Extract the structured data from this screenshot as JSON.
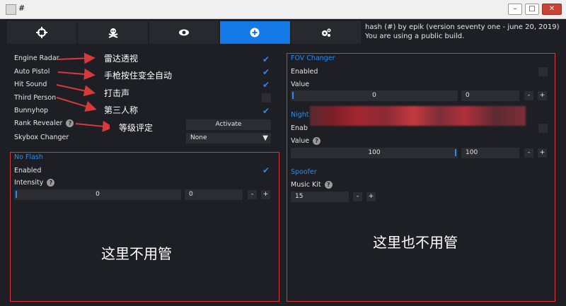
{
  "window": {
    "title": "#"
  },
  "tabs": [
    {
      "name": "aim-tab",
      "icon": "crosshair-icon"
    },
    {
      "name": "skull-tab",
      "icon": "skull-crossbones-icon"
    },
    {
      "name": "visuals-tab",
      "icon": "eye-icon"
    },
    {
      "name": "misc-tab",
      "icon": "plus-circle-icon",
      "active": true
    },
    {
      "name": "settings-tab",
      "icon": "gears-icon"
    }
  ],
  "info": {
    "line1": "hash (#) by epik (version seventy one - june 20, 2019)",
    "line2": "You are using a public build."
  },
  "misc": {
    "engine_radar": "Engine Radar",
    "auto_pistol": "Auto Pistol",
    "hit_sound": "Hit Sound",
    "third_person": "Third Person",
    "bunnyhop": "Bunnyhop",
    "rank_revealer": "Rank Revealer",
    "rank_activate": "Activate",
    "skybox_changer": "Skybox Changer",
    "skybox_value": "None"
  },
  "no_flash": {
    "title": "No Flash",
    "enabled": "Enabled",
    "intensity": "Intensity",
    "value1": "0",
    "value2": "0",
    "minus": "-",
    "plus": "+"
  },
  "fov_changer": {
    "title": "FOV Changer",
    "enabled": "Enabled",
    "value_label": "Value",
    "value1": "0",
    "value2": "0",
    "minus": "-",
    "plus": "+"
  },
  "night": {
    "title_partial": "Night",
    "enabled_partial": "Enab",
    "value_label": "Value",
    "value1": "100",
    "value2": "100",
    "minus": "-",
    "plus": "+"
  },
  "spoofer": {
    "title": "Spoofer",
    "music_kit": "Music Kit",
    "value": "15",
    "minus": "-",
    "plus": "+"
  },
  "annotations": {
    "radar": "雷达透视",
    "auto_pistol": "手枪按住变全自动",
    "hit_sound": "打击声",
    "third_person": "第三人称",
    "rank": "等级评定",
    "left_note": "这里不用管",
    "right_note": "这里也不用管"
  },
  "colors": {
    "accent": "#2b8af2",
    "background": "#1e1f24",
    "annotation": "#d63a3a"
  }
}
